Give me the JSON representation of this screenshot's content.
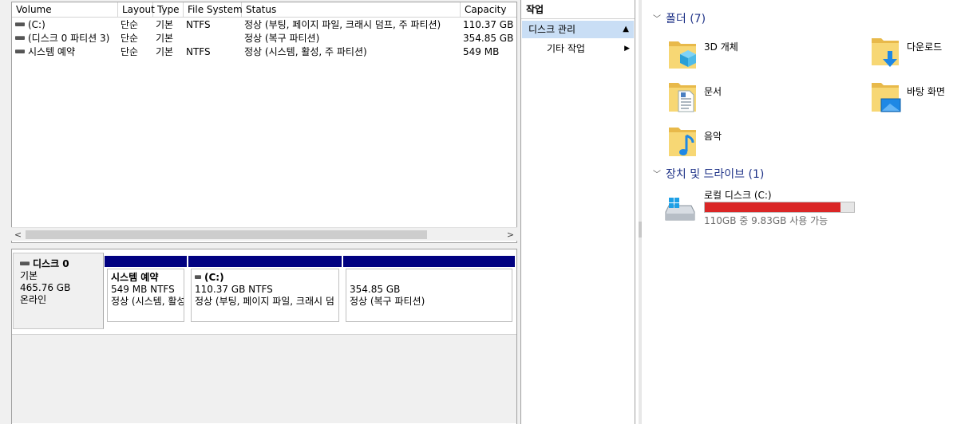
{
  "volume_table": {
    "headers": [
      "Volume",
      "Layout",
      "Type",
      "File System",
      "Status",
      "Capacity"
    ],
    "rows": [
      {
        "volume": "(C:)",
        "layout": "단순",
        "type": "기본",
        "fs": "NTFS",
        "status": "정상 (부팅, 페이지 파일, 크래시 덤프, 주 파티션)",
        "capacity": "110.37 GB"
      },
      {
        "volume": "(디스크 0 파티션 3)",
        "layout": "단순",
        "type": "기본",
        "fs": "",
        "status": "정상 (복구 파티션)",
        "capacity": "354.85 GB"
      },
      {
        "volume": "시스템 예약",
        "layout": "단순",
        "type": "기본",
        "fs": "NTFS",
        "status": "정상 (시스템, 활성, 주 파티션)",
        "capacity": "549 MB"
      }
    ],
    "scroll_left": "<",
    "scroll_right": ">"
  },
  "disk": {
    "name": "디스크 0",
    "type": "기본",
    "size": "465.76 GB",
    "state": "온라인",
    "partitions": [
      {
        "name": "시스템 예약",
        "size_fs": "549 MB NTFS",
        "status": "정상 (시스템, 활성"
      },
      {
        "name": "(C:)",
        "size_fs": "110.37 GB NTFS",
        "status": "정상 (부팅, 페이지 파일, 크래시 덤"
      },
      {
        "name": "",
        "size_fs": "354.85 GB",
        "status": "정상 (복구 파티션)"
      }
    ]
  },
  "actions": {
    "title": "작업",
    "selected": "디스크 관리",
    "more": "기타 작업"
  },
  "explorer": {
    "folders_header": "폴더 (7)",
    "folders": [
      {
        "label": "3D 개체",
        "icon": "3d-objects-icon"
      },
      {
        "label": "다운로드",
        "icon": "downloads-icon"
      },
      {
        "label": "문서",
        "icon": "documents-icon"
      },
      {
        "label": "바탕 화면",
        "icon": "desktop-icon"
      },
      {
        "label": "음악",
        "icon": "music-icon"
      }
    ],
    "drives_header": "장치 및 드라이브 (1)",
    "drive": {
      "label": "로컬 디스크 (C:)",
      "free_text": "110GB 중 9.83GB 사용 가능",
      "used_fraction": 0.91,
      "bar_color": "#da2626"
    }
  },
  "colors": {
    "partition_bar": "#000080",
    "selection": "#c9def5",
    "group_header": "#1e3287"
  }
}
